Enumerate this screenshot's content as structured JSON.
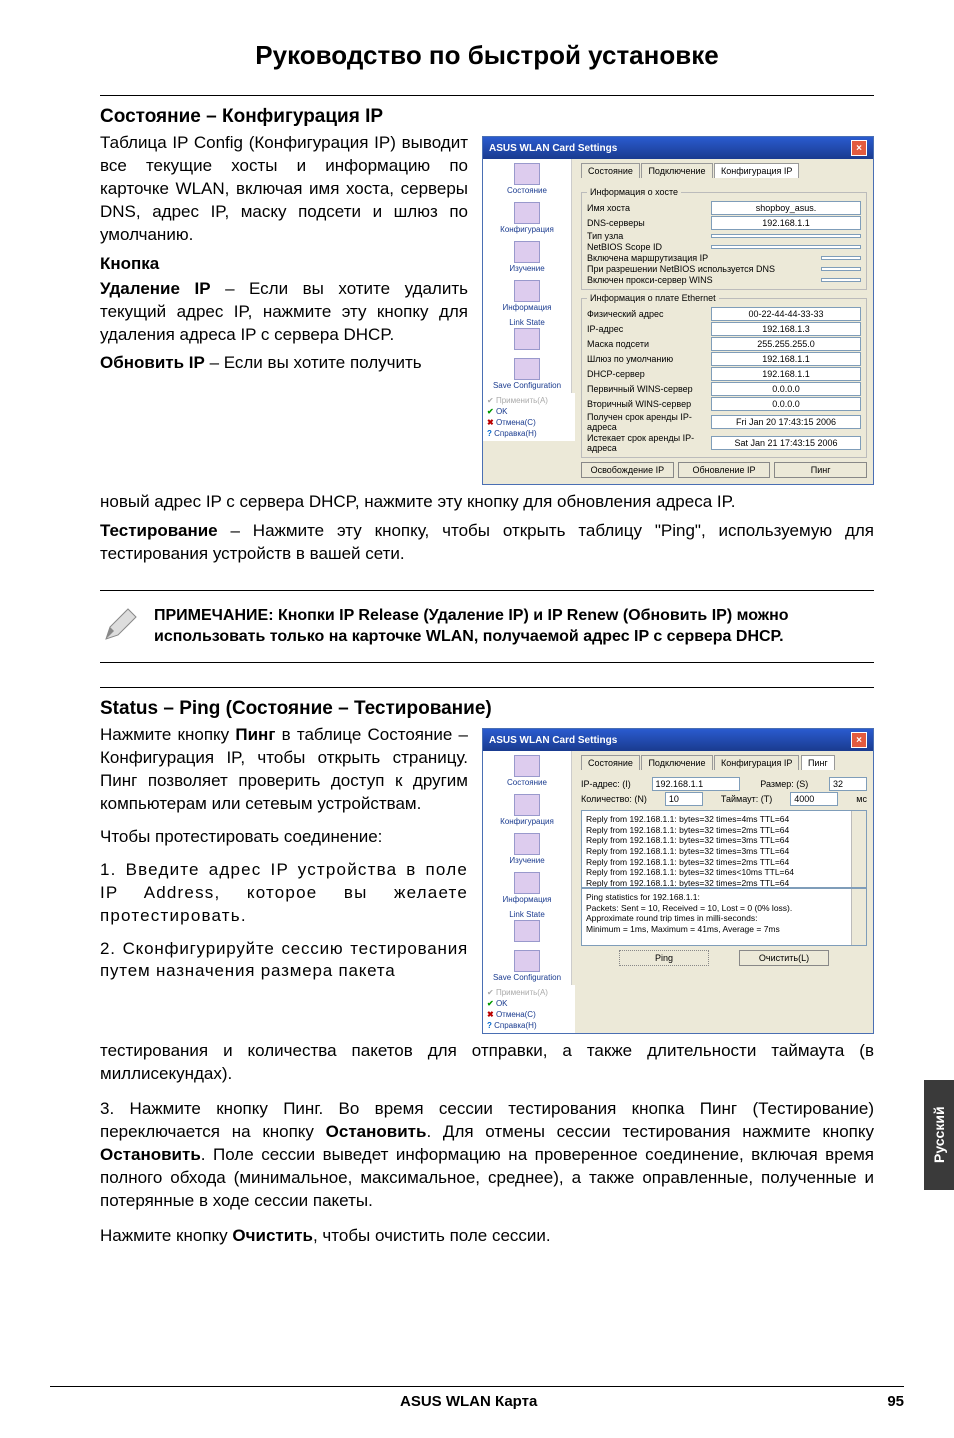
{
  "page": {
    "title": "Руководство по быстрой установке",
    "side_tab": "Русский",
    "footer_product": "ASUS WLAN Карта",
    "footer_page": "95"
  },
  "sec_ipconfig": {
    "heading": "Состояние – Конфигурация IP",
    "para1": "Таблица IP Config (Конфигурация IP) выводит все текущие хосты и информацию по карточке WLAN, включая имя хоста, серверы DNS, адрес IP, маску подсети и шлюз по умолчанию.",
    "sub1": "Кнопка",
    "para2_lead": "Удаление IP",
    "para2_body": " – Если вы хотите удалить текущий адрес IP, нажмите эту кнопку для удаления адреса IP с сервера DHCP.",
    "para3_lead": "Обновить IP",
    "para3_body": " – Если вы хотите получить",
    "para3_cont": "новый адрес IP с сервера DHCP, нажмите эту кнопку для обновления адреса IP.",
    "para4_lead": "Тестирование",
    "para4_body": " – Нажмите эту кнопку, чтобы открыть таблицу \"Ping\", используемую для тестирования устройств в вашей сети."
  },
  "note": {
    "text": "ПРИМЕЧАНИЕ: Кнопки IP Release (Удаление IP) и IP Renew (Обновить IP) можно использовать только на карточке WLAN, получаемой адрес IP с сервера DHCP."
  },
  "sec_ping": {
    "heading": "Status – Ping (Состояние – Тестирование)",
    "para1_a": "Нажмите кнопку ",
    "para1_b": "Пинг",
    "para1_c": " в таблице Состояние – Конфигурация IP, чтобы открыть страницу. Пинг позволяет проверить доступ к другим компьютерам или сетевым устройствам.",
    "para2": "Чтобы протестировать соединение:",
    "step1": "1. Введите адрес IP устройства в поле IP Address, которое вы желаете протестировать.",
    "step2a": "2. Сконфигурируйте сессию тестирования путем назначения размера пакета",
    "step2b": "тестирования и количества пакетов для отправки, а также длительности таймаута (в миллисекундах).",
    "step3a": "3. Нажмите кнопку Пинг. Во время сессии тестирования кнопка Пинг (Тестирование) переключается на кнопку ",
    "step3b": "Остановить",
    "step3c": ".  Для отмены сессии тестирования нажмите кнопку ",
    "step3d": "Остановить",
    "step3e": ".  Поле сессии выведет информацию на проверенное соединение, включая время полного обхода (минимальное, максимальное, среднее), а также оправленные, полученные и потерянные в ходе сессии пакеты.",
    "para_last_a": "Нажмите кнопку ",
    "para_last_b": "Очистить",
    "para_last_c": ", чтобы очистить поле сессии."
  },
  "win1": {
    "title": "ASUS WLAN Card Settings",
    "tabs": [
      "Состояние",
      "Подключение",
      "Конфигурация IP"
    ],
    "sidebar": [
      "Состояние",
      "Конфигурация",
      "Изучение",
      "Информация",
      "Link State",
      "Save Configuration"
    ],
    "fs1_legend": "Информация о хосте",
    "host_lbl": "Имя хоста",
    "host_val": "shopboy_asus.",
    "dns_lbl": "DNS-серверы",
    "dns_val": "192.168.1.1",
    "nodetype_lbl": "Тип узла",
    "scope_lbl": "NetBIOS Scope ID",
    "rout_lbl": "Включена маршрутизация IP",
    "netbios_lbl": "При разрешении NetBIOS используется DNS",
    "wins_lbl": "Включен прокси-сервер WINS",
    "fs2_legend": "Информация о плате Ethernet",
    "mac_lbl": "Физический адрес",
    "mac_val": "00-22-44-44-33-33",
    "ip_lbl": "IP-адрес",
    "ip_val": "192.168.1.3",
    "mask_lbl": "Маска подсети",
    "mask_val": "255.255.255.0",
    "gw_lbl": "Шлюз по умолчанию",
    "gw_val": "192.168.1.1",
    "dhcp_lbl": "DHCP-сервер",
    "dhcp_val": "192.168.1.1",
    "wins1_lbl": "Первичный WINS-сервер",
    "wins1_val": "0.0.0.0",
    "wins2_lbl": "Вторичный WINS-сервер",
    "wins2_val": "0.0.0.0",
    "lease1_lbl": "Получен срок аренды IP-адреса",
    "lease1_val": "Fri Jan 20 17:43:15 2006",
    "lease2_lbl": "Истекает срок аренды IP-адреса",
    "lease2_val": "Sat Jan 21 17:43:15 2006",
    "btn_release": "Освобождение IP",
    "btn_renew": "Обновление IP",
    "btn_ping": "Пинг",
    "foot_ok": "OK",
    "foot_cancel": "Отмена(C)",
    "foot_help": "Справка(H)",
    "foot_apply": "Применить(A)"
  },
  "win2": {
    "title": "ASUS WLAN Card Settings",
    "tabs": [
      "Состояние",
      "Подключение",
      "Конфигурация IP",
      "Пинг"
    ],
    "ip_lbl": "IP-адрес: (I)",
    "ip_val": "192.168.1.1",
    "size_lbl": "Размер: (S)",
    "size_val": "32",
    "count_lbl": "Количество: (N)",
    "count_val": "10",
    "timeout_lbl": "Таймаут: (T)",
    "timeout_val": "4000",
    "timeout_unit": "мс",
    "replies": [
      "Reply from 192.168.1.1: bytes=32 times=4ms TTL=64",
      "Reply from 192.168.1.1: bytes=32 times=2ms TTL=64",
      "Reply from 192.168.1.1: bytes=32 times=3ms TTL=64",
      "Reply from 192.168.1.1: bytes=32 times=3ms TTL=64",
      "Reply from 192.168.1.1: bytes=32 times=2ms TTL=64",
      "Reply from 192.168.1.1: bytes=32 times<10ms TTL=64",
      "Reply from 192.168.1.1: bytes=32 times=2ms TTL=64"
    ],
    "stats": [
      "Ping statistics for 192.168.1.1:",
      "    Packets: Sent = 10, Received = 10, Lost = 0 (0% loss).",
      "Approximate round trip times in milli-seconds:",
      "    Minimum = 1ms, Maximum = 41ms, Average = 7ms"
    ],
    "btn_ping": "Ping",
    "btn_clear": "Очистить(L)"
  }
}
